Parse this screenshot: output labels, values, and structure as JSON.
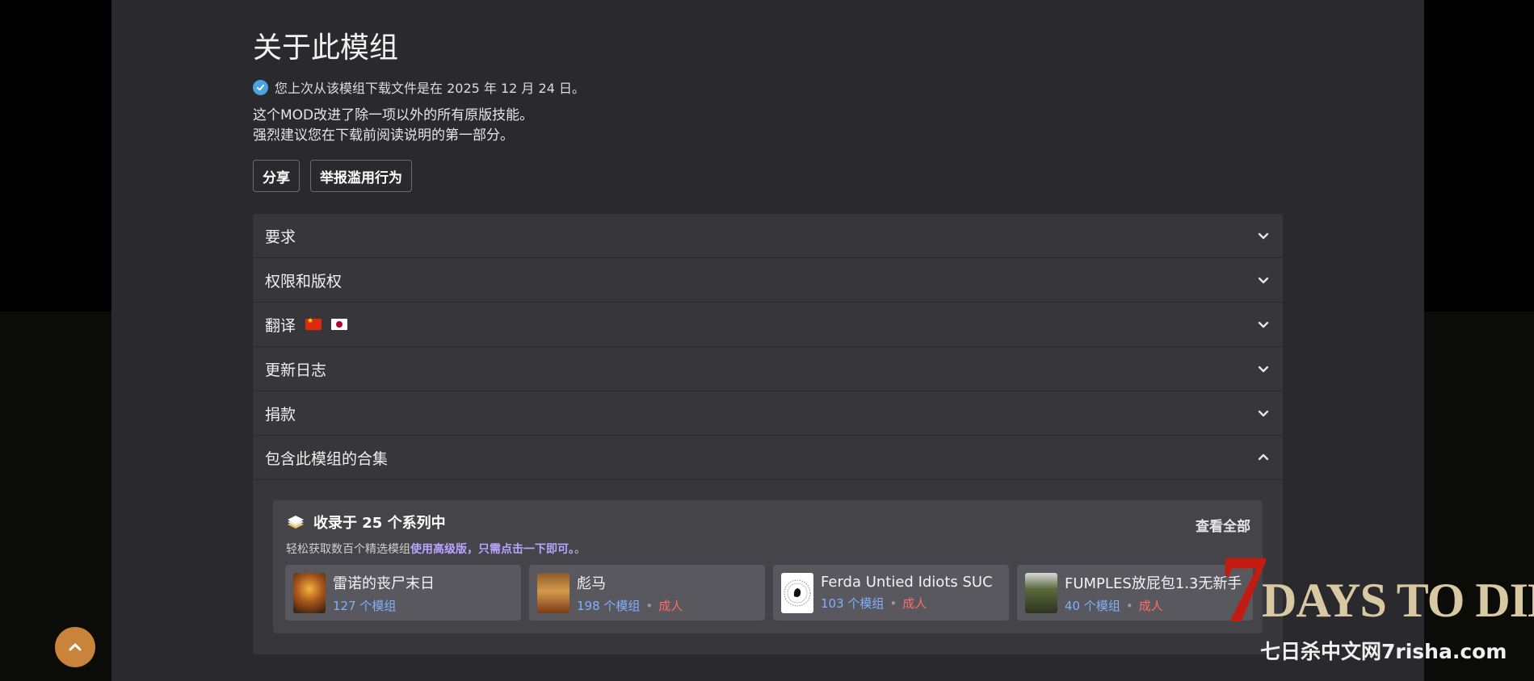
{
  "about": {
    "title": "关于此模组",
    "download_notice": "您上次从该模组下载文件是在 2025 年 12 月 24 日。",
    "description_line1": "这个MOD改进了除一项以外的所有原版技能。",
    "description_line2": "强烈建议您在下载前阅读说明的第一部分。"
  },
  "buttons": {
    "share": "分享",
    "report": "举报滥用行为"
  },
  "accordion": {
    "requirements": "要求",
    "permissions": "权限和版权",
    "translations": "翻译",
    "changelog": "更新日志",
    "donations": "捐款",
    "collections": "包含此模组的合集"
  },
  "collections": {
    "title": "收录于 25 个系列中",
    "view_all": "查看全部",
    "subtitle_prefix": "轻松获取数百个精选模组",
    "subtitle_link1": "使用高级版",
    "subtitle_comma": "，",
    "subtitle_link2": "只需点击一下即可。",
    "subtitle_suffix": "。",
    "items": [
      {
        "name": "雷诺的丧尸末日",
        "count": "127 个模组",
        "adult": ""
      },
      {
        "name": "彪马",
        "count": "198 个模组",
        "adult": "成人"
      },
      {
        "name": "Ferda Untied Idiots SUC",
        "count": "103 个模组",
        "adult": "成人"
      },
      {
        "name": "FUMPLES放屁包1.3无新手",
        "count": "40 个模组",
        "adult": "成人"
      }
    ]
  },
  "watermark": {
    "seven": "7",
    "title": "DAYS TO DIE",
    "subtitle": "七日杀中文网7risha.com"
  },
  "colors": {
    "panel": "#2a2a2e",
    "accordion": "#36363b",
    "accent_blue": "#4aa3df",
    "count_blue": "#7fb0ff",
    "adult_red": "#ff6b6b",
    "scroll_button": "#c9833a"
  }
}
